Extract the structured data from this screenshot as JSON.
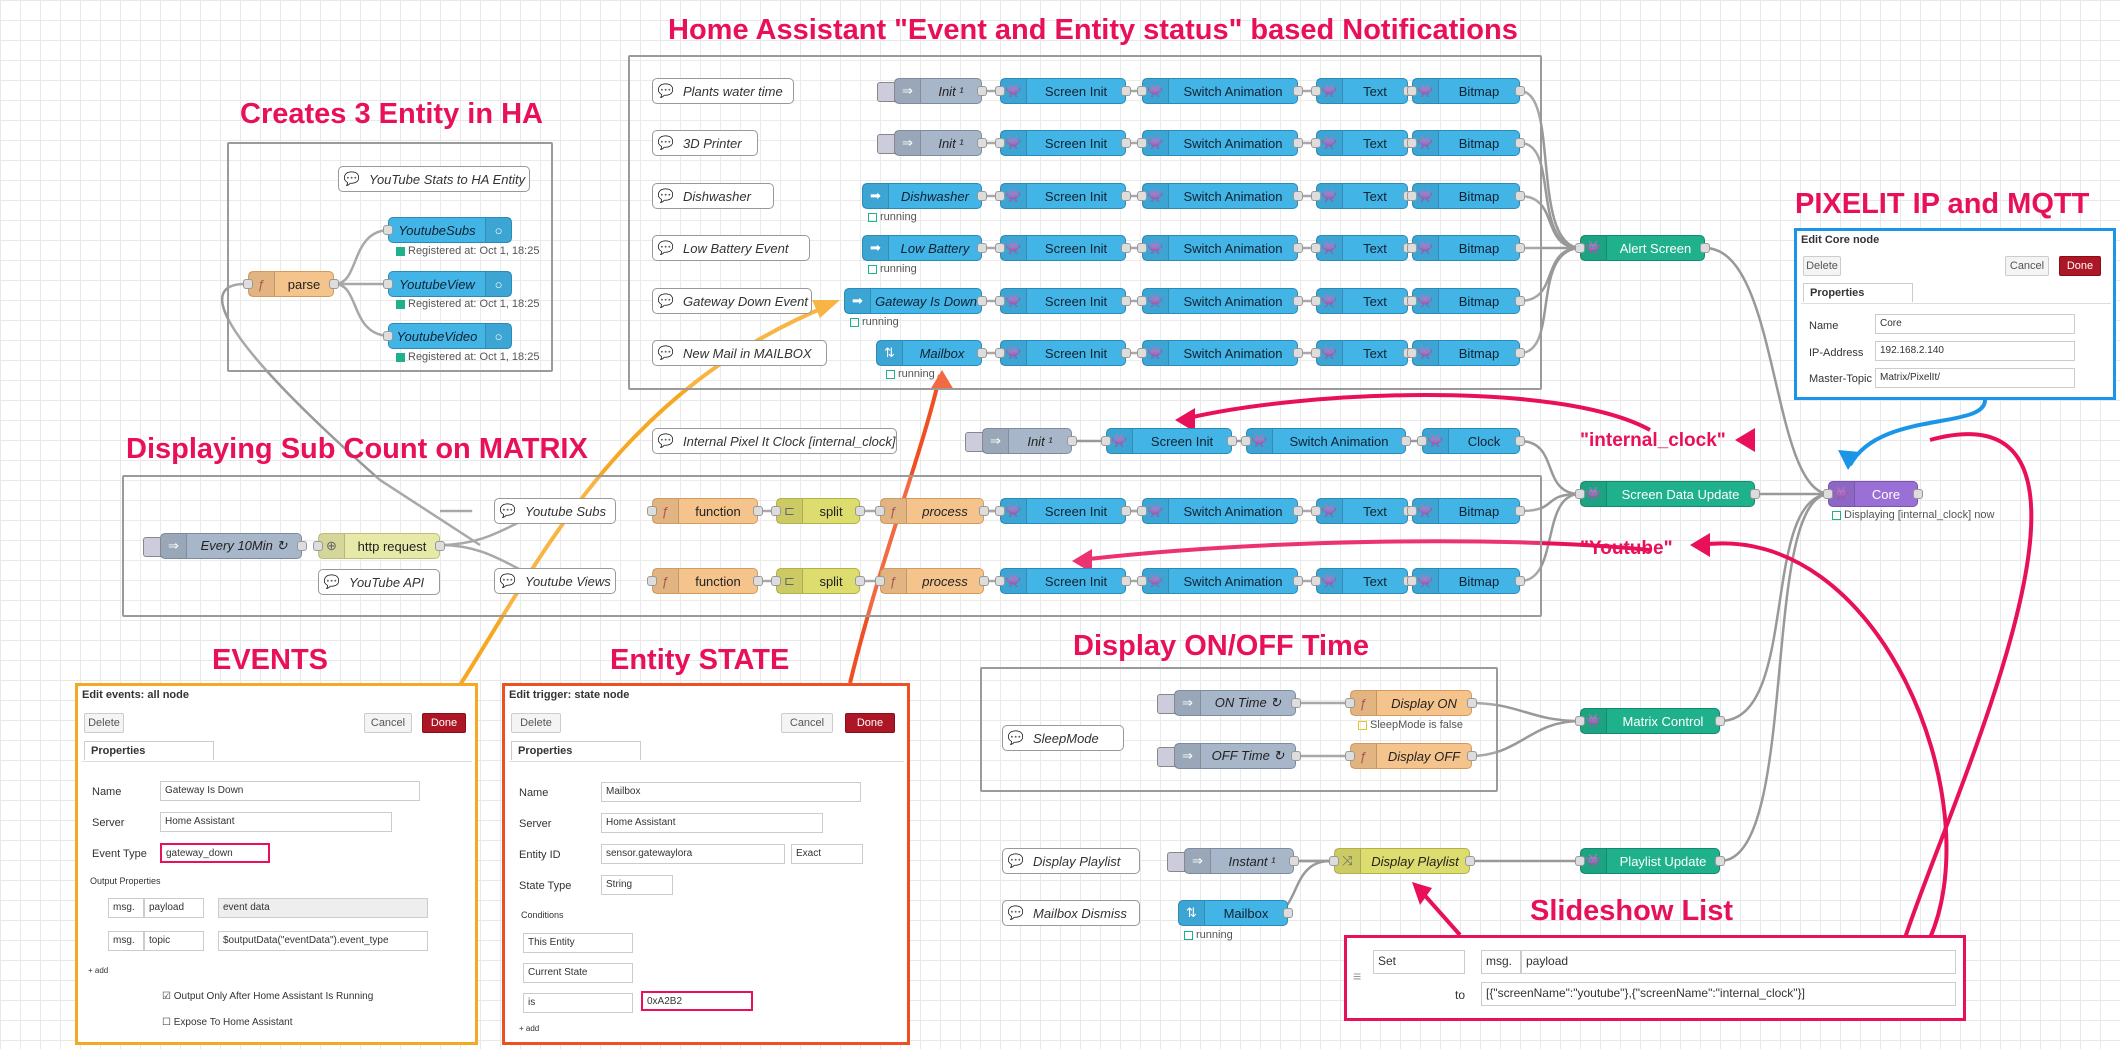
{
  "titles": {
    "main": "Home Assistant \"Event and Entity status\" based Notifications",
    "entity": "Creates 3 Entity in HA",
    "subcount": "Displaying Sub Count on MATRIX",
    "pixelit": "PIXELIT IP and MQTT",
    "events": "EVENTS",
    "entity_state": "Entity STATE",
    "display_time": "Display ON/OFF Time",
    "slideshow": "Slideshow List"
  },
  "labels": {
    "internal_clock": "\"internal_clock\"",
    "youtube": "\"Youtube\""
  },
  "colors": {
    "accent": "#e8105a",
    "events_border": "#f7a823",
    "entity_border": "#ef5023",
    "pixelit_border": "#1a95e8"
  },
  "nodes": {
    "c_plants": "Plants water time",
    "c_3d": "3D Printer",
    "c_dish": "Dishwasher",
    "c_lowbat": "Low Battery Event",
    "c_gateway": "Gateway Down Event",
    "c_mail": "New Mail in MAILBOX",
    "init": "Init ¹",
    "dishwasher": "Dishwasher",
    "low_battery": "Low Battery",
    "gateway": "Gateway Is Down",
    "mailbox": "Mailbox",
    "screen_init": "Screen Init",
    "switch_anim": "Switch Animation",
    "text": "Text",
    "bitmap": "Bitmap",
    "clock": "Clock",
    "alert_screen": "Alert Screen",
    "screen_data_update": "Screen Data Update",
    "core": "Core",
    "matrix_control": "Matrix Control",
    "playlist_update": "Playlist Update",
    "c_yt_stats": "YouTube Stats to HA Entity",
    "parse": "parse",
    "yt_subs": "YoutubeSubs",
    "yt_view": "YoutubeView",
    "yt_video": "YoutubeVideo",
    "c_internal_clock": "Internal Pixel It Clock [internal_clock]",
    "every10": "Every 10Min ↻",
    "http": "http request",
    "c_yt_api": "YouTube API",
    "c_yt_subs": "Youtube Subs",
    "c_yt_views": "Youtube Views",
    "function": "function",
    "split": "split",
    "process": "process",
    "c_sleep": "SleepMode",
    "on_time": "ON Time ↻",
    "off_time": "OFF Time ↻",
    "display_on": "Display ON",
    "display_off": "Display OFF",
    "c_playlist": "Display Playlist",
    "c_mail_dismiss": "Mailbox Dismiss",
    "instant": "Instant ¹",
    "display_playlist": "Display Playlist",
    "mailbox2": "Mailbox"
  },
  "status": {
    "running": "running",
    "registered": "Registered at: Oct 1, 18:25",
    "core": "Displaying [internal_clock] now",
    "sleep": "SleepMode is false"
  },
  "core_panel": {
    "title": "Edit Core node",
    "delete": "Delete",
    "cancel": "Cancel",
    "done": "Done",
    "tab": "Properties",
    "name_l": "Name",
    "name_v": "Core",
    "ip_l": "IP-Address",
    "ip_v": "192.168.2.140",
    "topic_l": "Master-Topic",
    "topic_v": "Matrix/PixelIt/"
  },
  "events_panel": {
    "title": "Edit events: all node",
    "delete": "Delete",
    "cancel": "Cancel",
    "done": "Done",
    "tab": "Properties",
    "name_l": "Name",
    "name_v": "Gateway Is Down",
    "server_l": "Server",
    "server_v": "Home Assistant",
    "type_l": "Event Type",
    "type_v": "gateway_down",
    "output": "Output Properties",
    "msg": "msg.",
    "p1": "payload",
    "v1": "event data",
    "p2": "topic",
    "v2": "$outputData(\"eventData\").event_type",
    "add": "+ add",
    "chk1": "Output Only After Home Assistant Is Running",
    "chk2": "Expose To Home Assistant"
  },
  "trigger_panel": {
    "title": "Edit trigger: state node",
    "delete": "Delete",
    "cancel": "Cancel",
    "done": "Done",
    "tab": "Properties",
    "name_l": "Name",
    "name_v": "Mailbox",
    "server_l": "Server",
    "server_v": "Home Assistant",
    "entity_l": "Entity ID",
    "entity_v": "sensor.gatewaylora",
    "exact": "Exact",
    "state_l": "State Type",
    "state_v": "String",
    "conditions": "Conditions",
    "c1": "This Entity",
    "c2": "Current State",
    "c3": "is",
    "c3v": "0xA2B2",
    "add": "+ add"
  },
  "slide_panel": {
    "set": "Set",
    "msg": "msg.",
    "payload": "payload",
    "to": "to",
    "json": "[{\"screenName\":\"youtube\"},{\"screenName\":\"internal_clock\"}]"
  }
}
